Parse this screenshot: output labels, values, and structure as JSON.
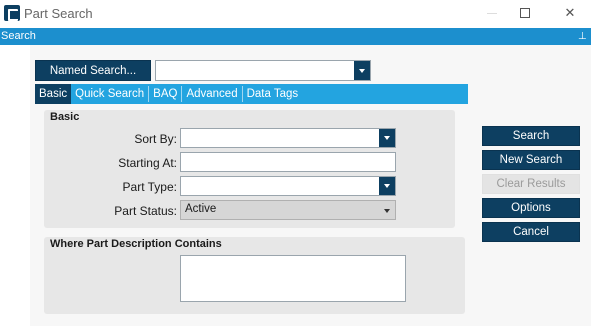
{
  "window": {
    "title": "Part Search"
  },
  "panel": {
    "title": "Search"
  },
  "named_search": {
    "button_label": "Named Search...",
    "value": ""
  },
  "tabs": [
    {
      "label": "Basic",
      "active": true
    },
    {
      "label": "Quick Search",
      "active": false
    },
    {
      "label": "BAQ",
      "active": false
    },
    {
      "label": "Advanced",
      "active": false
    },
    {
      "label": "Data Tags",
      "active": false
    }
  ],
  "basic_group": {
    "title": "Basic",
    "sort_by": {
      "label": "Sort By:",
      "value": ""
    },
    "starting_at": {
      "label": "Starting At:",
      "value": ""
    },
    "part_type": {
      "label": "Part Type:",
      "value": ""
    },
    "part_status": {
      "label": "Part Status:",
      "value": "Active"
    }
  },
  "description_group": {
    "title": "Where Part Description Contains",
    "value": ""
  },
  "actions": {
    "search": "Search",
    "new_search": "New Search",
    "clear_results": "Clear Results",
    "options": "Options",
    "cancel": "Cancel"
  },
  "colors": {
    "brand_dark": "#0d3f61",
    "header_blue": "#1c8fce",
    "tab_blue": "#23a4e0"
  }
}
